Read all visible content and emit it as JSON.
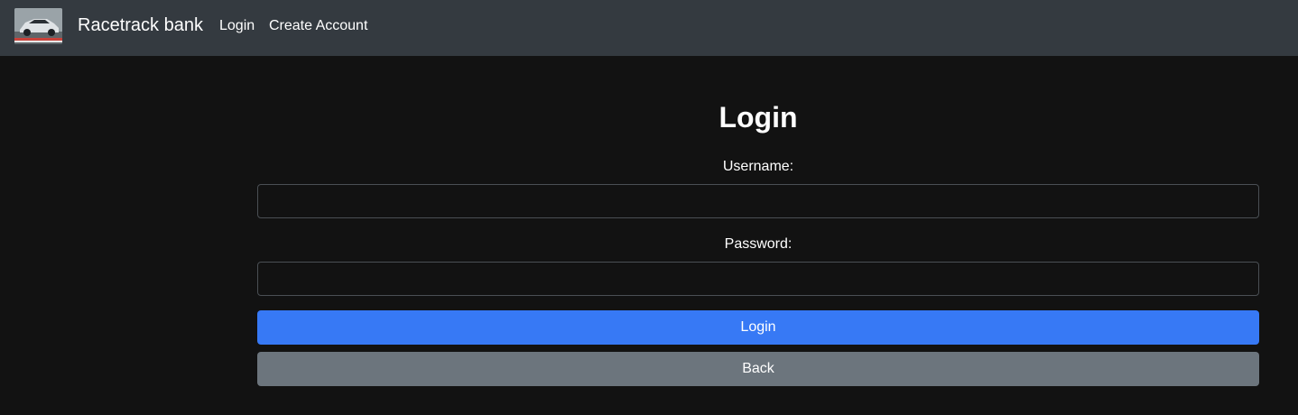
{
  "navbar": {
    "logo_icon": "race-car-photo",
    "brand": "Racetrack bank",
    "links": [
      {
        "label": "Login"
      },
      {
        "label": "Create Account"
      }
    ],
    "background": "#343a40"
  },
  "form": {
    "title": "Login",
    "username_label": "Username:",
    "username_value": "",
    "password_label": "Password:",
    "password_value": "",
    "login_button": "Login",
    "back_button": "Back"
  },
  "colors": {
    "page_background": "#121212",
    "primary": "#3779f5",
    "secondary": "#6c757d"
  }
}
